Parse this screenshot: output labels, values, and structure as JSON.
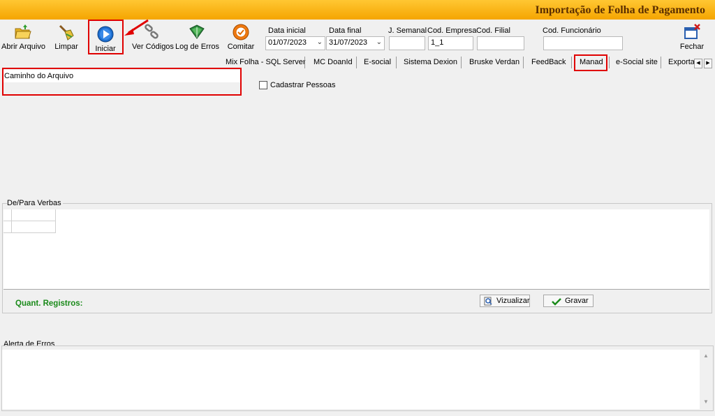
{
  "window": {
    "title": "Importação de Folha de Pagamento"
  },
  "toolbar": {
    "open_file": "Abrir Arquivo",
    "clear": "Limpar",
    "start": "Iniciar",
    "view_codes": "Ver Códigos",
    "error_log": "Log de Erros",
    "commit": "Comitar",
    "close": "Fechar"
  },
  "filters": {
    "start_date_label": "Data inicial",
    "start_date": "01/07/2023",
    "end_date_label": "Data final",
    "end_date": "31/07/2023",
    "weekly_label": "J. Semanal",
    "weekly": "",
    "company_label": "Cod. Empresa",
    "company": "1_1",
    "branch_label": "Cod. Filial",
    "branch": "",
    "employee_label": "Cod. Funcionário",
    "employee": ""
  },
  "tabs": [
    "Mix Folha - SQL Server",
    "MC DoanId",
    "E-social",
    "Sistema Dexion",
    "Bruske Verdan",
    "FeedBack",
    "Manad",
    "e-Social site",
    "Exporta"
  ],
  "selected_tab": "Manad",
  "file_path": {
    "label": "Caminho do Arquivo",
    "value": ""
  },
  "register_people": {
    "label": "Cadastrar Pessoas",
    "checked": false
  },
  "mapping": {
    "title": "De/Para Verbas",
    "records_label": "Quant. Registros:",
    "view_button": "Vizualizar",
    "save_button": "Gravar"
  },
  "errors": {
    "title": "Alerta de Erros"
  },
  "colors": {
    "title_bar": "#f5a500",
    "highlight": "#e00000",
    "records_label": "#1a8a1a"
  }
}
